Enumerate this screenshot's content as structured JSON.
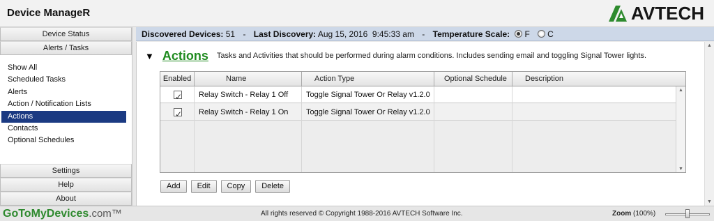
{
  "app": {
    "title": "Device ManageR",
    "brand": "AVTECH",
    "brand_color": "#2e8b2e"
  },
  "nav": {
    "top_buttons": [
      "Device Status",
      "Alerts / Tasks"
    ],
    "items": [
      {
        "label": "Show All",
        "active": false
      },
      {
        "label": "Scheduled Tasks",
        "active": false
      },
      {
        "label": "Alerts",
        "active": false
      },
      {
        "label": "Action / Notification Lists",
        "active": false
      },
      {
        "label": "Actions",
        "active": true
      },
      {
        "label": "Contacts",
        "active": false
      },
      {
        "label": "Optional Schedules",
        "active": false
      }
    ],
    "bottom_buttons": [
      "Settings",
      "Help",
      "About"
    ]
  },
  "infobar": {
    "discovered_label": "Discovered Devices:",
    "discovered_value": "51",
    "dash1": "-",
    "last_label": "Last Discovery:",
    "last_value": "Aug 15, 2016  9:45:33 am",
    "dash2": "-",
    "temp_label": "Temperature Scale:",
    "opt_f": "F",
    "opt_c": "C",
    "selected": "F"
  },
  "section": {
    "title": "Actions",
    "description": "Tasks and Activities that should be performed during alarm conditions. Includes sending email and toggling Signal Tower lights."
  },
  "table": {
    "columns": [
      "Enabled",
      "Name",
      "Action Type",
      "Optional Schedule",
      "Description"
    ],
    "rows": [
      {
        "enabled": true,
        "name": "Relay Switch - Relay 1 Off",
        "action_type": "Toggle Signal Tower Or Relay v1.2.0",
        "schedule": "",
        "description": ""
      },
      {
        "enabled": true,
        "name": "Relay Switch - Relay 1 On",
        "action_type": "Toggle Signal Tower Or Relay v1.2.0",
        "schedule": "",
        "description": ""
      }
    ]
  },
  "buttons": {
    "add": "Add",
    "edit": "Edit",
    "copy": "Copy",
    "delete": "Delete"
  },
  "footer": {
    "site": "GoToMyDevices",
    "site_suffix": ".com™",
    "copyright": "All rights reserved © Copyright 1988-2016 AVTECH Software Inc.",
    "zoom_label": "Zoom",
    "zoom_value": "(100%)"
  }
}
